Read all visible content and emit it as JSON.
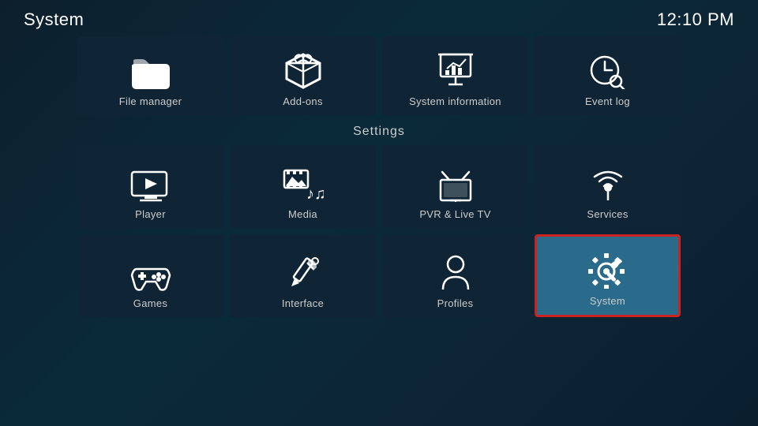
{
  "header": {
    "title": "System",
    "time": "12:10 PM"
  },
  "top_items": [
    {
      "id": "file-manager",
      "label": "File manager"
    },
    {
      "id": "add-ons",
      "label": "Add-ons"
    },
    {
      "id": "system-information",
      "label": "System information"
    },
    {
      "id": "event-log",
      "label": "Event log"
    }
  ],
  "settings_label": "Settings",
  "grid_row1": [
    {
      "id": "player",
      "label": "Player"
    },
    {
      "id": "media",
      "label": "Media"
    },
    {
      "id": "pvr-live-tv",
      "label": "PVR & Live TV"
    },
    {
      "id": "services",
      "label": "Services"
    }
  ],
  "grid_row2": [
    {
      "id": "games",
      "label": "Games"
    },
    {
      "id": "interface",
      "label": "Interface"
    },
    {
      "id": "profiles",
      "label": "Profiles"
    },
    {
      "id": "system",
      "label": "System"
    }
  ]
}
